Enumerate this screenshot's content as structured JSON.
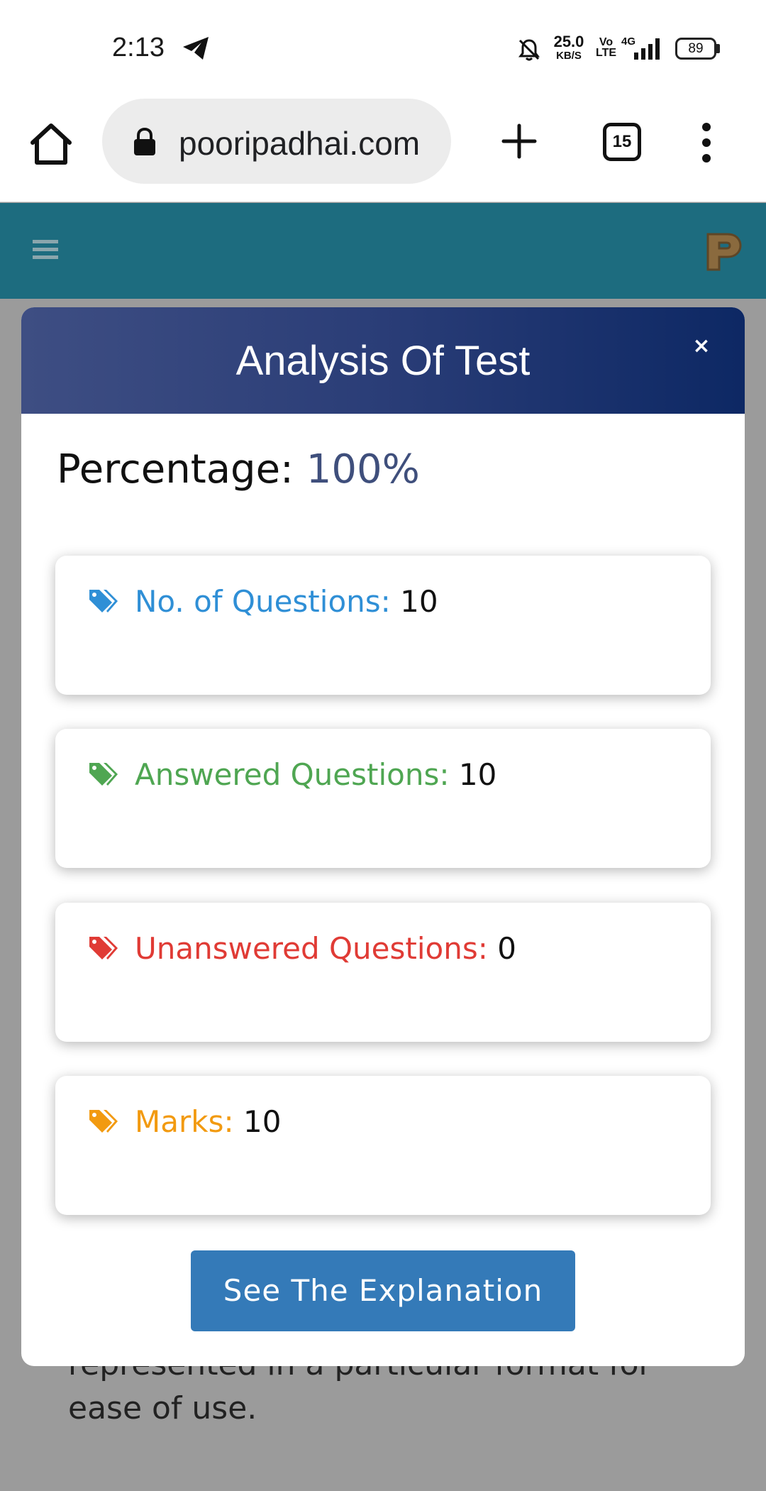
{
  "status_bar": {
    "time": "2:13",
    "net_speed": "25.0",
    "net_speed_unit": "KB/S",
    "volte_top": "Vo",
    "volte_bottom": "LTE",
    "network": "4G",
    "battery": "89"
  },
  "browser": {
    "url": "pooripadhai.com",
    "tab_count": "15"
  },
  "site_header": {
    "logo_letter": "P"
  },
  "background_text": "represented in a particular format for ease of use.",
  "modal": {
    "title": "Analysis Of Test",
    "close_label": "×",
    "percentage_label": "Percentage:",
    "percentage_value": "100%",
    "stats": [
      {
        "label": "No. of Questions:",
        "value": "10",
        "color": "#2f8fd6"
      },
      {
        "label": "Answered Questions:",
        "value": "10",
        "color": "#4fa652"
      },
      {
        "label": "Unanswered Questions:",
        "value": "0",
        "color": "#e03b35"
      },
      {
        "label": "Marks:",
        "value": "10",
        "color": "#f29a10"
      }
    ],
    "explanation_button": "See The Explanation"
  },
  "colors": {
    "header_teal": "#1d6c7f",
    "modal_header_start": "#3e4e83",
    "modal_header_end": "#0d2864",
    "button_blue": "#347ab8",
    "overlay_gray": "#9b9b9b"
  }
}
